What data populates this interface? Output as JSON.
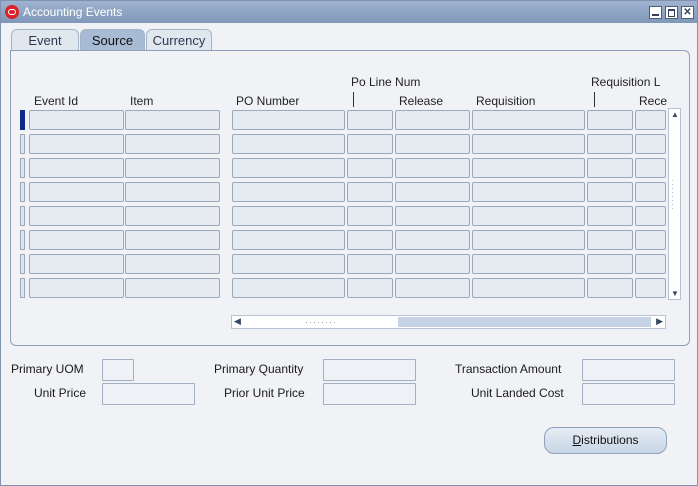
{
  "window": {
    "title": "Accounting Events"
  },
  "tabs": [
    {
      "label": "Event",
      "active": false
    },
    {
      "label": "Source",
      "active": true
    },
    {
      "label": "Currency",
      "active": false
    }
  ],
  "grid": {
    "headers": {
      "event_id": "Event Id",
      "item": "Item",
      "po_number": "PO Number",
      "po_line_num": "Po Line Num",
      "release": "Release",
      "requisition": "Requisition",
      "requisition_line": "Requisition L",
      "receipt": "Rece"
    },
    "rows": 8
  },
  "fields": {
    "primary_uom": {
      "label": "Primary UOM",
      "value": ""
    },
    "unit_price": {
      "label": "Unit Price",
      "value": ""
    },
    "primary_quantity": {
      "label": "Primary Quantity",
      "value": ""
    },
    "prior_unit_price": {
      "label": "Prior Unit Price",
      "value": ""
    },
    "transaction_amount": {
      "label": "Transaction Amount",
      "value": ""
    },
    "unit_landed_cost": {
      "label": "Unit Landed Cost",
      "value": ""
    }
  },
  "buttons": {
    "distributions_underline": "D",
    "distributions_rest": "istributions"
  },
  "icons": {
    "app": "oracle-icon",
    "minimize": "minimize-icon",
    "maximize": "maximize-icon",
    "close": "close-icon"
  }
}
